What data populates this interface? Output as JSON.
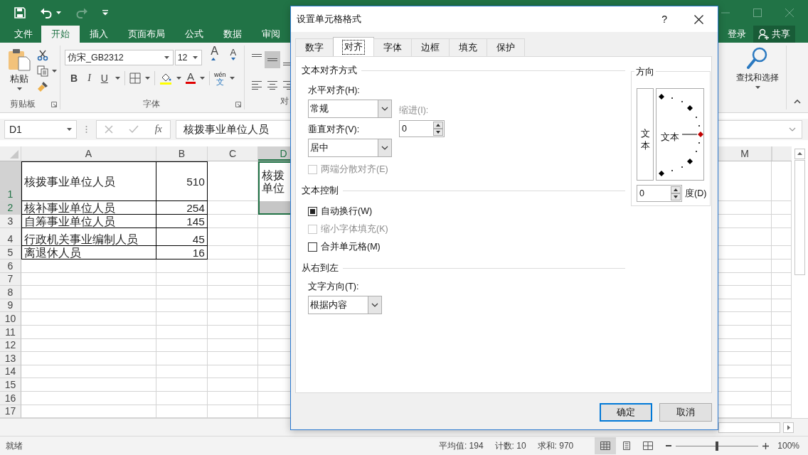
{
  "title_bar": {
    "quick_access": [
      {
        "kind": "save",
        "disabled": false
      },
      {
        "kind": "undo",
        "disabled": false
      },
      {
        "kind": "redo",
        "disabled": true
      },
      {
        "kind": "customize",
        "disabled": false
      }
    ]
  },
  "ribbon_tabs": [
    {
      "label": "文件",
      "selected": false
    },
    {
      "label": "开始",
      "selected": true
    },
    {
      "label": "插入",
      "selected": false
    },
    {
      "label": "页面布局",
      "selected": false
    },
    {
      "label": "公式",
      "selected": false
    },
    {
      "label": "数据",
      "selected": false
    },
    {
      "label": "审阅",
      "selected": false
    }
  ],
  "account": {
    "sign_in": "登录",
    "share": "共享"
  },
  "ribbon": {
    "clipboard": {
      "paste": "粘贴",
      "label": "剪贴板"
    },
    "font": {
      "name": "仿宋_GB2312",
      "size": "12",
      "grow": "A",
      "shrink": "A",
      "bold": "B",
      "italic": "I",
      "underline": "U",
      "font_color": "A",
      "phonetic_top": "wén",
      "phonetic_bottom": "文",
      "label": "字体"
    },
    "alignment": {
      "buttons": [
        {
          "kind": "top",
          "selected": false
        },
        {
          "kind": "middle",
          "selected": true
        },
        {
          "kind": "bottom",
          "selected": false
        },
        {
          "kind": "left",
          "selected": false
        },
        {
          "kind": "center",
          "selected": false
        },
        {
          "kind": "right",
          "selected": false
        }
      ],
      "label": "对"
    },
    "editing": {
      "find_select": "查找和选择"
    }
  },
  "formula_bar": {
    "name_box": "D1",
    "function_label": "fx",
    "formula": "核拨事业单位人员"
  },
  "grid": {
    "columns": [
      {
        "label": "A",
        "selected": false
      },
      {
        "label": "B",
        "selected": false
      },
      {
        "label": "C",
        "selected": false
      },
      {
        "label": "D",
        "selected": true
      },
      {
        "label": "M",
        "selected": false
      }
    ],
    "rows": [
      {
        "label": "1",
        "selected": true,
        "bordered": true,
        "cell_a": "核拨事业单位人员",
        "cell_b": "510",
        "cell_d_lines": [
          "核拨",
          "单位"
        ]
      },
      {
        "label": "2",
        "selected": true,
        "bordered": true,
        "cell_a": "核补事业单位人员",
        "cell_b": "254"
      },
      {
        "label": "3",
        "selected": false,
        "bordered": true,
        "cell_a": "自筹事业单位人员",
        "cell_b": "145"
      },
      {
        "label": "4",
        "selected": false,
        "bordered": true,
        "cell_a": "行政机关事业编制人员",
        "cell_b": "45"
      },
      {
        "label": "5",
        "selected": false,
        "bordered": true,
        "cell_a": "离退休人员",
        "cell_b": "16"
      },
      {
        "label": "6",
        "selected": false,
        "bordered": false
      },
      {
        "label": "7",
        "selected": false,
        "bordered": false
      },
      {
        "label": "8",
        "selected": false,
        "bordered": false
      },
      {
        "label": "9",
        "selected": false,
        "bordered": false
      },
      {
        "label": "10",
        "selected": false,
        "bordered": false
      },
      {
        "label": "11",
        "selected": false,
        "bordered": false
      },
      {
        "label": "12",
        "selected": false,
        "bordered": false
      },
      {
        "label": "13",
        "selected": false,
        "bordered": false
      },
      {
        "label": "14",
        "selected": false,
        "bordered": false
      },
      {
        "label": "15",
        "selected": false,
        "bordered": false
      },
      {
        "label": "16",
        "selected": false,
        "bordered": false
      },
      {
        "label": "17",
        "selected": false,
        "bordered": false
      }
    ]
  },
  "status_bar": {
    "ready": "就绪",
    "average": "平均值: 194",
    "count": "计数: 10",
    "sum": "求和: 970",
    "views": [
      {
        "kind": "normal",
        "selected": true
      },
      {
        "kind": "page_layout",
        "selected": false
      },
      {
        "kind": "page_break",
        "selected": false
      }
    ],
    "zoom": {
      "level": 0.5
    },
    "zoom_label": "100%"
  },
  "dialog": {
    "title": "设置单元格格式",
    "help": "?",
    "tabs": [
      {
        "label": "数字",
        "selected": false
      },
      {
        "label": "对齐",
        "selected": true
      },
      {
        "label": "字体",
        "selected": false
      },
      {
        "label": "边框",
        "selected": false
      },
      {
        "label": "填充",
        "selected": false
      },
      {
        "label": "保护",
        "selected": false
      }
    ],
    "text_alignment": {
      "heading": "文本对齐方式",
      "horizontal_label": "水平对齐(H):",
      "horizontal_value": "常规",
      "indent_label": "缩进(I):",
      "indent_disabled": true,
      "indent_value": "0",
      "vertical_label": "垂直对齐(V):",
      "vertical_value": "居中",
      "distributed": {
        "label": "两端分散对齐(E)",
        "checked": false,
        "indeterminate": false,
        "disabled": true
      }
    },
    "text_control": {
      "heading": "文本控制",
      "options": [
        {
          "label": "自动换行(W)",
          "checked": true,
          "indeterminate": true,
          "disabled": false
        },
        {
          "label": "缩小字体填充(K)",
          "checked": false,
          "indeterminate": false,
          "disabled": true
        },
        {
          "label": "合并单元格(M)",
          "checked": false,
          "indeterminate": false,
          "disabled": false
        }
      ]
    },
    "right_to_left": {
      "heading": "从右到左",
      "direction_label": "文字方向(T):",
      "direction_value": "根据内容"
    },
    "orientation": {
      "heading": "方向",
      "vertical_text": "文本",
      "dial_text": "文本",
      "degrees": "0",
      "degrees_label": "度(D)"
    },
    "buttons": [
      {
        "label": "确定",
        "default": true
      },
      {
        "label": "取消",
        "default": false
      }
    ]
  }
}
